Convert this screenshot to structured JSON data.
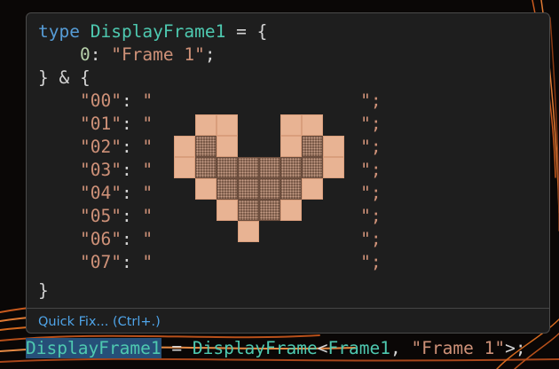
{
  "code": {
    "line1": {
      "kw": "type",
      "name": "DisplayFrame1",
      "rest": " = {"
    },
    "line2": {
      "key": "0",
      "sep": ": ",
      "value": "\"Frame 1\"",
      "end": ";"
    },
    "line3": "} & {",
    "rows": [
      {
        "key": "\"00\"",
        "sep": ": ",
        "open": "\"",
        "close": "\";"
      },
      {
        "key": "\"01\"",
        "sep": ": ",
        "open": "\"",
        "close": "\";"
      },
      {
        "key": "\"02\"",
        "sep": ": ",
        "open": "\"",
        "close": "\";"
      },
      {
        "key": "\"03\"",
        "sep": ": ",
        "open": "\"",
        "close": "\";"
      },
      {
        "key": "\"04\"",
        "sep": ": ",
        "open": "\"",
        "close": "\";"
      },
      {
        "key": "\"05\"",
        "sep": ": ",
        "open": "\"",
        "close": "\";"
      },
      {
        "key": "\"06\"",
        "sep": ": ",
        "open": "\"",
        "close": "\";"
      },
      {
        "key": "\"07\"",
        "sep": ": ",
        "open": "\"",
        "close": "\";"
      }
    ],
    "closing": "}"
  },
  "heart": {
    "pixel_color": "#e8b393",
    "fill_color": "#7a5a48",
    "grid": [
      "..........",
      ".11..11...",
      "1D1..1D1..",
      "1DDDDDD1..",
      ".1DDDD1...",
      "..1DD1....",
      "...1......",
      ".........."
    ]
  },
  "quick_fix": {
    "label": "Quick Fix... (Ctrl+.)"
  },
  "editor_line": {
    "name": "DisplayFrame1",
    "eq": " = ",
    "type": "DisplayFrame",
    "lt": "<",
    "arg1": "Frame1",
    "comma": ", ",
    "arg2": "\"Frame 1\"",
    "end": ">;"
  },
  "colors": {
    "keyword": "#569cd6",
    "type": "#4ec9b0",
    "number": "#b5cea8",
    "string": "#ce9178",
    "link": "#4fa4e8",
    "panel_bg": "#1e1e1e"
  }
}
